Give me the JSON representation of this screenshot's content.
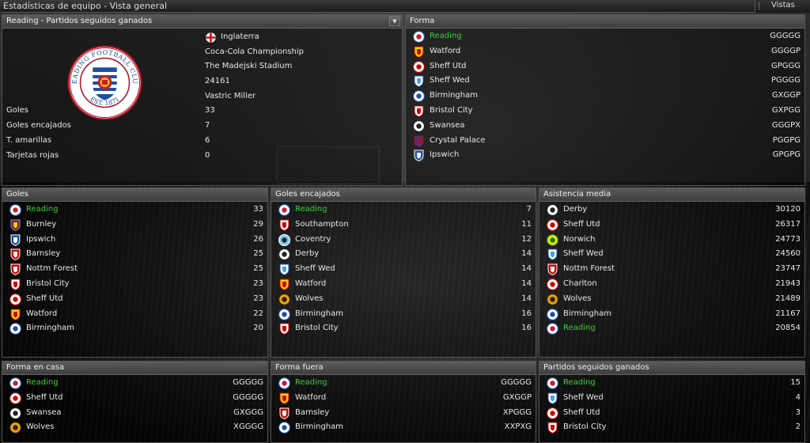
{
  "window": {
    "title": "Estadísticas de equipo - Vista general",
    "views_label": "Vistas"
  },
  "colors": {
    "highlight": "#3ecb3e",
    "panel_header": "#4c4c4c",
    "reading_blue": "#1e50a2"
  },
  "club_panel": {
    "title": "Reading - Partidos seguidos ganados",
    "country": "Inglaterra",
    "competition": "Coca-Cola Championship",
    "stadium": "The Madejski Stadium",
    "capacity": "24161",
    "manager": "Vastric Miller",
    "logo_text_top": "READING FOOTBALL CLUB",
    "logo_text_bottom": "EST. 1871",
    "stats": [
      {
        "label": "Goles",
        "value": "33"
      },
      {
        "label": "Goles encajados",
        "value": "7"
      },
      {
        "label": "T. amarillas",
        "value": "6"
      },
      {
        "label": "Tarjetas rojas",
        "value": "0"
      }
    ]
  },
  "form_panel": {
    "title": "Forma",
    "rows": [
      {
        "team": "Reading",
        "value": "GGGGG",
        "crest": "reading",
        "highlight": true
      },
      {
        "team": "Watford",
        "value": "GGGGP",
        "crest": "watford"
      },
      {
        "team": "Sheff Utd",
        "value": "GPGGG",
        "crest": "sheffutd"
      },
      {
        "team": "Sheff Wed",
        "value": "PGGGG",
        "crest": "sheffwed"
      },
      {
        "team": "Birmingham",
        "value": "GXGGP",
        "crest": "birmingham"
      },
      {
        "team": "Bristol City",
        "value": "GXPGG",
        "crest": "bristol"
      },
      {
        "team": "Swansea",
        "value": "GGGPX",
        "crest": "swansea"
      },
      {
        "team": "Crystal Palace",
        "value": "PGGPG",
        "crest": "palace"
      },
      {
        "team": "Ipswich",
        "value": "GPGPG",
        "crest": "ipswich"
      }
    ]
  },
  "goals_panel": {
    "title": "Goles",
    "rows": [
      {
        "team": "Reading",
        "value": "33",
        "crest": "reading",
        "highlight": true
      },
      {
        "team": "Burnley",
        "value": "29",
        "crest": "burnley"
      },
      {
        "team": "Ipswich",
        "value": "26",
        "crest": "ipswich"
      },
      {
        "team": "Barnsley",
        "value": "25",
        "crest": "barnsley"
      },
      {
        "team": "Nottm Forest",
        "value": "25",
        "crest": "forest"
      },
      {
        "team": "Bristol City",
        "value": "23",
        "crest": "bristol"
      },
      {
        "team": "Sheff Utd",
        "value": "23",
        "crest": "sheffutd"
      },
      {
        "team": "Watford",
        "value": "22",
        "crest": "watford"
      },
      {
        "team": "Birmingham",
        "value": "20",
        "crest": "birmingham"
      }
    ]
  },
  "conceded_panel": {
    "title": "Goles encajados",
    "rows": [
      {
        "team": "Reading",
        "value": "7",
        "crest": "reading",
        "highlight": true
      },
      {
        "team": "Southampton",
        "value": "11",
        "crest": "southampton"
      },
      {
        "team": "Coventry",
        "value": "12",
        "crest": "coventry"
      },
      {
        "team": "Derby",
        "value": "14",
        "crest": "derby"
      },
      {
        "team": "Sheff Wed",
        "value": "14",
        "crest": "sheffwed"
      },
      {
        "team": "Watford",
        "value": "14",
        "crest": "watford"
      },
      {
        "team": "Wolves",
        "value": "14",
        "crest": "wolves"
      },
      {
        "team": "Birmingham",
        "value": "16",
        "crest": "birmingham"
      },
      {
        "team": "Bristol City",
        "value": "16",
        "crest": "bristol"
      }
    ]
  },
  "attendance_panel": {
    "title": "Asistencia media",
    "rows": [
      {
        "team": "Derby",
        "value": "30120",
        "crest": "derby"
      },
      {
        "team": "Sheff Utd",
        "value": "26317",
        "crest": "sheffutd"
      },
      {
        "team": "Norwich",
        "value": "24773",
        "crest": "norwich"
      },
      {
        "team": "Sheff Wed",
        "value": "24560",
        "crest": "sheffwed"
      },
      {
        "team": "Nottm Forest",
        "value": "23747",
        "crest": "forest"
      },
      {
        "team": "Charlton",
        "value": "21943",
        "crest": "charlton"
      },
      {
        "team": "Wolves",
        "value": "21489",
        "crest": "wolves"
      },
      {
        "team": "Birmingham",
        "value": "21167",
        "crest": "birmingham"
      },
      {
        "team": "Reading",
        "value": "20854",
        "crest": "reading",
        "highlight": true
      }
    ]
  },
  "home_form_panel": {
    "title": "Forma en casa",
    "rows": [
      {
        "team": "Reading",
        "value": "GGGGG",
        "crest": "reading",
        "highlight": true
      },
      {
        "team": "Sheff Utd",
        "value": "GGGGG",
        "crest": "sheffutd"
      },
      {
        "team": "Swansea",
        "value": "GXGGG",
        "crest": "swansea"
      },
      {
        "team": "Wolves",
        "value": "XGGGG",
        "crest": "wolves"
      }
    ]
  },
  "away_form_panel": {
    "title": "Forma fuera",
    "rows": [
      {
        "team": "Reading",
        "value": "GGGGG",
        "crest": "reading",
        "highlight": true
      },
      {
        "team": "Watford",
        "value": "GXGGP",
        "crest": "watford"
      },
      {
        "team": "Barnsley",
        "value": "XPGGG",
        "crest": "barnsley"
      },
      {
        "team": "Birmingham",
        "value": "XXPXG",
        "crest": "birmingham"
      }
    ]
  },
  "streak_panel": {
    "title": "Partidos seguidos ganados",
    "rows": [
      {
        "team": "Reading",
        "value": "15",
        "crest": "reading",
        "highlight": true
      },
      {
        "team": "Sheff Wed",
        "value": "4",
        "crest": "sheffwed"
      },
      {
        "team": "Sheff Utd",
        "value": "3",
        "crest": "sheffutd"
      },
      {
        "team": "Bristol City",
        "value": "2",
        "crest": "bristol"
      }
    ]
  }
}
